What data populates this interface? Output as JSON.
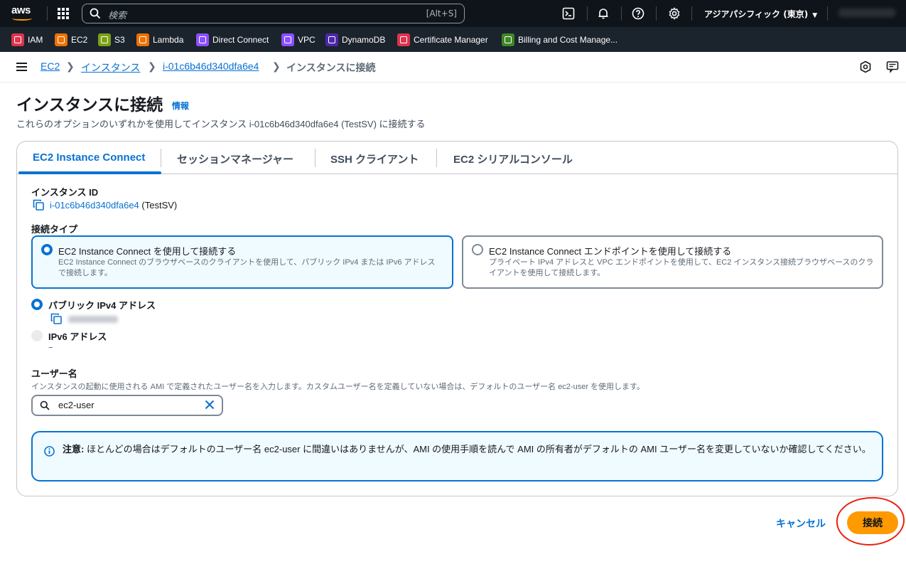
{
  "topbar": {
    "logo_text": "aws",
    "search_placeholder": "検索",
    "search_shortcut": "[Alt+S]",
    "region": "アジアパシフィック (東京)"
  },
  "favorites": [
    {
      "label": "IAM",
      "color": "#dd344c"
    },
    {
      "label": "EC2",
      "color": "#ed7100"
    },
    {
      "label": "S3",
      "color": "#7aa116"
    },
    {
      "label": "Lambda",
      "color": "#ed7100"
    },
    {
      "label": "Direct Connect",
      "color": "#8c4fff"
    },
    {
      "label": "VPC",
      "color": "#8c4fff"
    },
    {
      "label": "DynamoDB",
      "color": "#4d27aa"
    },
    {
      "label": "Certificate Manager",
      "color": "#dd344c"
    },
    {
      "label": "Billing and Cost Manage...",
      "color": "#3f8624"
    }
  ],
  "breadcrumb": {
    "items": [
      "EC2",
      "インスタンス",
      "i-01c6b46d340dfa6e4"
    ],
    "current": "インスタンスに接続"
  },
  "page": {
    "title": "インスタンスに接続",
    "info": "情報",
    "description": "これらのオプションのいずれかを使用してインスタンス i-01c6b46d340dfa6e4 (TestSV) に接続する"
  },
  "tabs": [
    "EC2 Instance Connect",
    "セッションマネージャー",
    "SSH クライアント",
    "EC2 シリアルコンソール"
  ],
  "instance": {
    "label": "インスタンス ID",
    "id": "i-01c6b46d340dfa6e4",
    "name": " (TestSV)"
  },
  "connection_type": {
    "label": "接続タイプ",
    "options": [
      {
        "title": "EC2 Instance Connect を使用して接続する",
        "desc": "EC2 Instance Connect のブラウザベースのクライアントを使用して、パブリック IPv4 または IPv6 アドレスで接続します。",
        "selected": true
      },
      {
        "title": "EC2 Instance Connect エンドポイントを使用して接続する",
        "desc": "プライベート IPv4 アドレスと VPC エンドポイントを使用して、EC2 インスタンス接続ブラウザベースのクライアントを使用して接続します。",
        "selected": false
      }
    ]
  },
  "address": {
    "ipv4_label": "パブリック IPv4 アドレス",
    "ipv6_label": "IPv6 アドレス",
    "ipv6_value": "–"
  },
  "username": {
    "label": "ユーザー名",
    "help": "インスタンスの起動に使用される AMI で定義されたユーザー名を入力します。カスタムユーザー名を定義していない場合は、デフォルトのユーザー名 ec2-user を使用します。",
    "value": "ec2-user"
  },
  "alert": {
    "strong": "注意:",
    "text": " ほとんどの場合はデフォルトのユーザー名 ec2-user に間違いはありませんが、AMI の使用手順を読んで AMI の所有者がデフォルトの AMI ユーザー名を変更していないか確認してください。"
  },
  "actions": {
    "cancel": "キャンセル",
    "connect": "接続"
  }
}
